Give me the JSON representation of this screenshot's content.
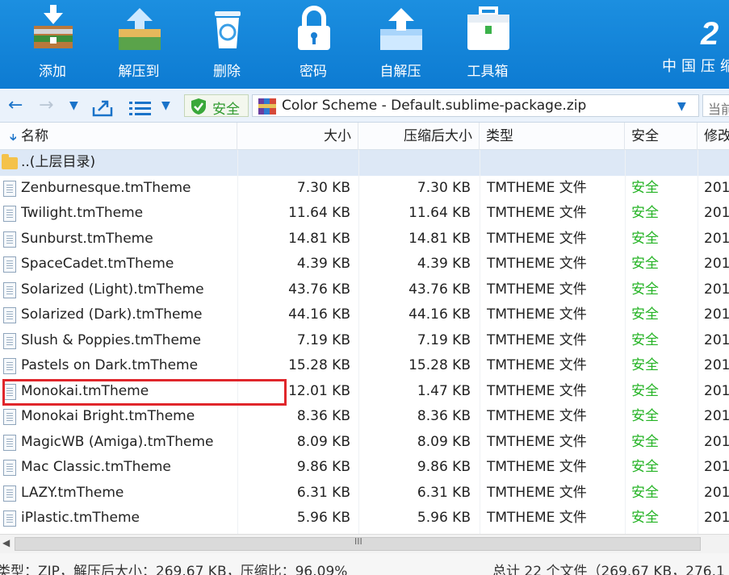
{
  "toolbar": {
    "buttons": [
      {
        "label": "添加",
        "icon": "add-archive-icon"
      },
      {
        "label": "解压到",
        "icon": "extract-to-icon"
      },
      {
        "label": "删除",
        "icon": "recycle-bin-icon"
      },
      {
        "label": "密码",
        "icon": "lock-icon"
      },
      {
        "label": "自解压",
        "icon": "self-extract-icon"
      },
      {
        "label": "工具箱",
        "icon": "toolbox-icon"
      }
    ],
    "brand_big": "2",
    "brand_small": "中国压缩"
  },
  "address": {
    "safe_label": "安全",
    "path": "Color Scheme - Default.sublime-package.zip",
    "current_label": "当前"
  },
  "columns": {
    "name": "名称",
    "size": "大小",
    "compressed": "压缩后大小",
    "type": "类型",
    "security": "安全",
    "modified": "修改"
  },
  "parent_row": "..(上层目录)",
  "files": [
    {
      "name": "Zenburnesque.tmTheme",
      "size": "7.30 KB",
      "compressed": "7.30 KB",
      "type": "TMTHEME 文件",
      "security": "安全",
      "modified": "201"
    },
    {
      "name": "Twilight.tmTheme",
      "size": "11.64 KB",
      "compressed": "11.64 KB",
      "type": "TMTHEME 文件",
      "security": "安全",
      "modified": "201"
    },
    {
      "name": "Sunburst.tmTheme",
      "size": "14.81 KB",
      "compressed": "14.81 KB",
      "type": "TMTHEME 文件",
      "security": "安全",
      "modified": "201"
    },
    {
      "name": "SpaceCadet.tmTheme",
      "size": "4.39 KB",
      "compressed": "4.39 KB",
      "type": "TMTHEME 文件",
      "security": "安全",
      "modified": "201"
    },
    {
      "name": "Solarized (Light).tmTheme",
      "size": "43.76 KB",
      "compressed": "43.76 KB",
      "type": "TMTHEME 文件",
      "security": "安全",
      "modified": "201"
    },
    {
      "name": "Solarized (Dark).tmTheme",
      "size": "44.16 KB",
      "compressed": "44.16 KB",
      "type": "TMTHEME 文件",
      "security": "安全",
      "modified": "201"
    },
    {
      "name": "Slush & Poppies.tmTheme",
      "size": "7.19 KB",
      "compressed": "7.19 KB",
      "type": "TMTHEME 文件",
      "security": "安全",
      "modified": "201"
    },
    {
      "name": "Pastels on Dark.tmTheme",
      "size": "15.28 KB",
      "compressed": "15.28 KB",
      "type": "TMTHEME 文件",
      "security": "安全",
      "modified": "201"
    },
    {
      "name": "Monokai.tmTheme",
      "size": "12.01 KB",
      "compressed": "1.47 KB",
      "type": "TMTHEME 文件",
      "security": "安全",
      "modified": "201"
    },
    {
      "name": "Monokai Bright.tmTheme",
      "size": "8.36 KB",
      "compressed": "8.36 KB",
      "type": "TMTHEME 文件",
      "security": "安全",
      "modified": "201"
    },
    {
      "name": "MagicWB (Amiga).tmTheme",
      "size": "8.09 KB",
      "compressed": "8.09 KB",
      "type": "TMTHEME 文件",
      "security": "安全",
      "modified": "201"
    },
    {
      "name": "Mac Classic.tmTheme",
      "size": "9.86 KB",
      "compressed": "9.86 KB",
      "type": "TMTHEME 文件",
      "security": "安全",
      "modified": "201"
    },
    {
      "name": "LAZY.tmTheme",
      "size": "6.31 KB",
      "compressed": "6.31 KB",
      "type": "TMTHEME 文件",
      "security": "安全",
      "modified": "201"
    },
    {
      "name": "iPlastic.tmTheme",
      "size": "5.96 KB",
      "compressed": "5.96 KB",
      "type": "TMTHEME 文件",
      "security": "安全",
      "modified": "201"
    }
  ],
  "scrollbar_grip": "III",
  "status": {
    "left": "类型：ZIP，解压后大小：269.67 KB，压缩比：96.09%",
    "right": "总计 22 个文件（269.67 KB，276.1"
  },
  "colors": {
    "toolbar_blue": "#1585da",
    "safe_green": "#24b324",
    "highlight_red": "#e0262b"
  }
}
